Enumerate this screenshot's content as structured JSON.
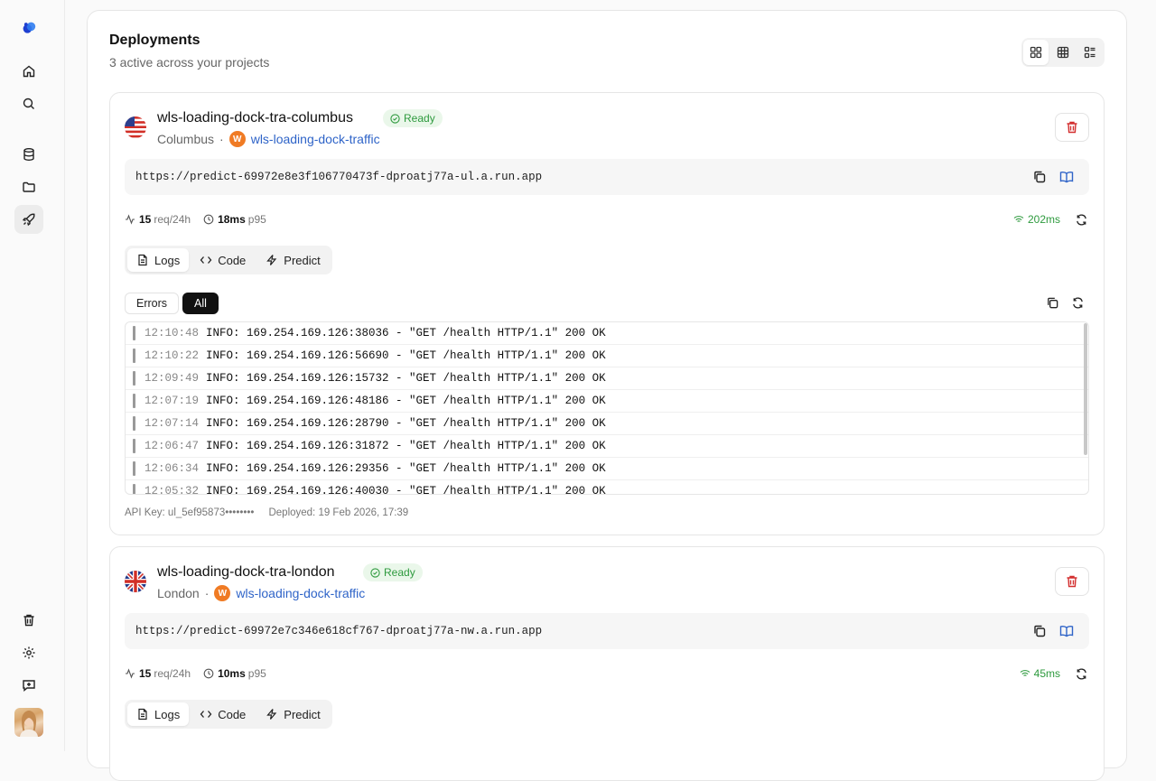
{
  "header": {
    "title": "Deployments",
    "subtitle": "3 active across your projects"
  },
  "sidebar": {
    "items": [
      {
        "icon": "logo-icon"
      },
      {
        "icon": "home-icon"
      },
      {
        "icon": "search-icon"
      },
      {
        "icon": "database-icon"
      },
      {
        "icon": "folder-icon"
      },
      {
        "icon": "rocket-icon"
      },
      {
        "icon": "trash-icon"
      },
      {
        "icon": "settings-icon"
      },
      {
        "icon": "feedback-icon"
      }
    ]
  },
  "deployments": [
    {
      "name": "wls-loading-dock-tra-columbus",
      "status": "Ready",
      "location": "Columbus",
      "sep": "·",
      "project_initial": "W",
      "project": "wls-loading-dock-traffic",
      "url": "https://predict-69972e8e3f106770473f-dproatj77a-ul.a.run.app",
      "requests": "15",
      "requests_unit": "req/24h",
      "p95": "18ms",
      "p95_unit": "p95",
      "latency": "202ms",
      "tabs": [
        "Logs",
        "Code",
        "Predict"
      ],
      "filters": [
        "Errors",
        "All"
      ],
      "logs": [
        {
          "time": "12:10:48",
          "msg": "INFO: 169.254.169.126:38036 - \"GET /health HTTP/1.1\" 200 OK"
        },
        {
          "time": "12:10:22",
          "msg": "INFO: 169.254.169.126:56690 - \"GET /health HTTP/1.1\" 200 OK"
        },
        {
          "time": "12:09:49",
          "msg": "INFO: 169.254.169.126:15732 - \"GET /health HTTP/1.1\" 200 OK"
        },
        {
          "time": "12:07:19",
          "msg": "INFO: 169.254.169.126:48186 - \"GET /health HTTP/1.1\" 200 OK"
        },
        {
          "time": "12:07:14",
          "msg": "INFO: 169.254.169.126:28790 - \"GET /health HTTP/1.1\" 200 OK"
        },
        {
          "time": "12:06:47",
          "msg": "INFO: 169.254.169.126:31872 - \"GET /health HTTP/1.1\" 200 OK"
        },
        {
          "time": "12:06:34",
          "msg": "INFO: 169.254.169.126:29356 - \"GET /health HTTP/1.1\" 200 OK"
        },
        {
          "time": "12:05:32",
          "msg": "INFO: 169.254.169.126:40030 - \"GET /health HTTP/1.1\" 200 OK"
        }
      ],
      "api_key": "API Key: ul_5ef95873••••••••",
      "deployed": "Deployed: 19 Feb 2026, 17:39"
    },
    {
      "name": "wls-loading-dock-tra-london",
      "status": "Ready",
      "location": "London",
      "sep": "·",
      "project_initial": "W",
      "project": "wls-loading-dock-traffic",
      "url": "https://predict-69972e7c346e618cf767-dproatj77a-nw.a.run.app",
      "requests": "15",
      "requests_unit": "req/24h",
      "p95": "10ms",
      "p95_unit": "p95",
      "latency": "45ms",
      "tabs": [
        "Logs",
        "Code",
        "Predict"
      ]
    }
  ],
  "colors": {
    "accent_link": "#2f64c8",
    "ready": "#2e9a3e",
    "danger": "#d32f2f",
    "project_badge": "#f07b24"
  }
}
